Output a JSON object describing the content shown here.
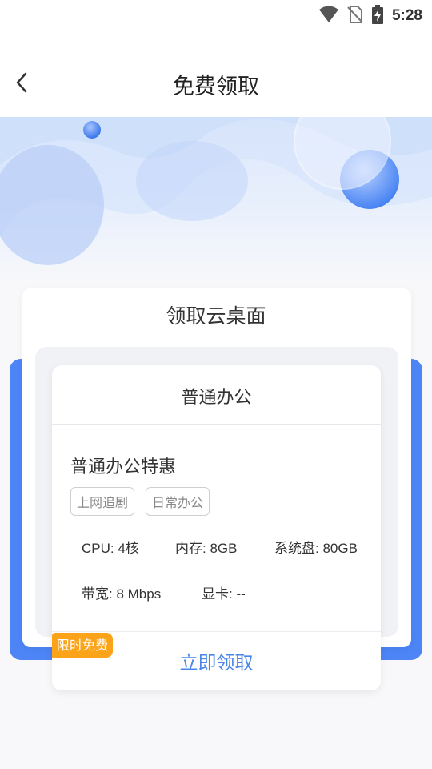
{
  "status_bar": {
    "time": "5:28",
    "icons": [
      "wifi-icon",
      "no-sim-icon",
      "battery-charging-icon"
    ]
  },
  "header": {
    "title": "免费领取",
    "back_icon": "chevron-left-icon"
  },
  "card": {
    "title": "领取云桌面",
    "plan": {
      "category": "普通办公",
      "name": "普通办公特惠",
      "tags": [
        "上网追剧",
        "日常办公"
      ],
      "specs": {
        "cpu": "CPU: 4核",
        "memory": "内存: 8GB",
        "disk": "系统盘: 80GB",
        "bandwidth": "带宽: 8 Mbps",
        "gpu": "显卡: --"
      },
      "badge": "限时免费",
      "claim_label": "立即领取"
    }
  },
  "colors": {
    "accent": "#4a86e8",
    "frame": "#4d85f6",
    "badge": "#fba41a"
  }
}
